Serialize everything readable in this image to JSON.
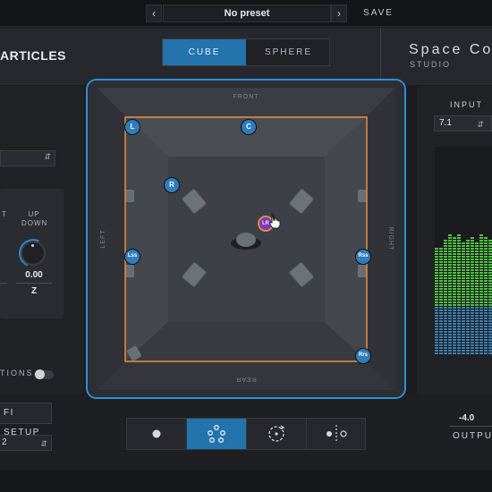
{
  "preset": {
    "prev_icon": "chevron-left-icon",
    "next_icon": "chevron-right-icon",
    "name": "No preset",
    "save_label": "SAVE"
  },
  "header": {
    "brand": "ARTICLES",
    "tabs": [
      {
        "label": "CUBE",
        "active": true
      },
      {
        "label": "SPHERE",
        "active": false
      }
    ],
    "product": "Space Co",
    "product_sub": "STUDIO"
  },
  "left_panel": {
    "labels": [
      "T",
      "UP\nDOWN"
    ],
    "value": "0.00",
    "axis": "Z",
    "options_label": "TIONS",
    "setup_label": "FI SETUP",
    "setup_select": "2"
  },
  "view": {
    "walls": {
      "front": "FRONT",
      "rear": "REAR",
      "left": "LEFT",
      "right": "RIGHT"
    },
    "speakers": [
      {
        "label": "L"
      },
      {
        "label": "C"
      },
      {
        "label": "R"
      },
      {
        "label": "Lss"
      },
      {
        "label": "Rss"
      },
      {
        "label": "Rrs"
      }
    ],
    "source_label": "LR"
  },
  "toolbar": {
    "tools": [
      {
        "icon": "single-dot-icon",
        "active": false
      },
      {
        "icon": "multi-dot-icon",
        "active": true
      },
      {
        "icon": "rotate-icon",
        "active": false
      },
      {
        "icon": "mirror-icon",
        "active": false
      }
    ]
  },
  "right_panel": {
    "input_label": "INPUT",
    "input_value": "7.1",
    "output_value": "-4.0",
    "output_label": "OUTPU",
    "meter_levels": [
      0.52,
      0.52,
      0.56,
      0.58,
      0.57,
      0.58,
      0.55,
      0.56,
      0.57,
      0.54,
      0.58,
      0.57,
      0.56
    ]
  },
  "colors": {
    "accent": "#2373ad",
    "frame": "#2f8fd6",
    "room_outline": "#e08a3c",
    "speaker": "#2f7dbd",
    "source": "#7b3ab8",
    "meter_green": "#4fbf3f",
    "meter_blue": "#3f7fb0"
  }
}
